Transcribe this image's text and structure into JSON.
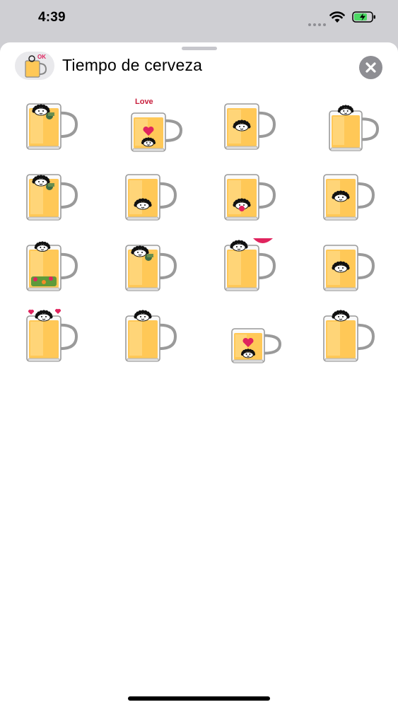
{
  "status_bar": {
    "time": "4:39",
    "icons": [
      "signal-dots-icon",
      "wifi-icon",
      "battery-charging-icon"
    ],
    "battery_color": "#4cd964"
  },
  "sheet": {
    "title": "Tiempo de cerveza",
    "app_icon": "beer-mug-ok-icon",
    "app_icon_badge": "OK",
    "close_icon": "close-icon"
  },
  "stickers": [
    {
      "name": "sticker-1",
      "variant": "face-top-bottle"
    },
    {
      "name": "sticker-2",
      "variant": "love-heart",
      "text": "Love"
    },
    {
      "name": "sticker-3",
      "variant": "face-middle"
    },
    {
      "name": "sticker-4",
      "variant": "face-peek-small"
    },
    {
      "name": "sticker-5",
      "variant": "face-top-bottle"
    },
    {
      "name": "sticker-6",
      "variant": "face-bottom"
    },
    {
      "name": "sticker-7",
      "variant": "face-bottom-red"
    },
    {
      "name": "sticker-8",
      "variant": "face-middle"
    },
    {
      "name": "sticker-9",
      "variant": "face-peek-veggies"
    },
    {
      "name": "sticker-10",
      "variant": "face-top-bottle"
    },
    {
      "name": "sticker-11",
      "variant": "face-peek-red-bubble"
    },
    {
      "name": "sticker-12",
      "variant": "face-middle"
    },
    {
      "name": "sticker-13",
      "variant": "face-peek-hearts"
    },
    {
      "name": "sticker-14",
      "variant": "face-peek"
    },
    {
      "name": "sticker-15",
      "variant": "love-heart-small"
    },
    {
      "name": "sticker-16",
      "variant": "face-peek"
    }
  ],
  "colors": {
    "beer": "#ffc857",
    "beer_light": "#ffe29a",
    "glass_outline": "#9a9a9a",
    "sheet_bg": "#ffffff",
    "backdrop": "#cfcfd3"
  }
}
